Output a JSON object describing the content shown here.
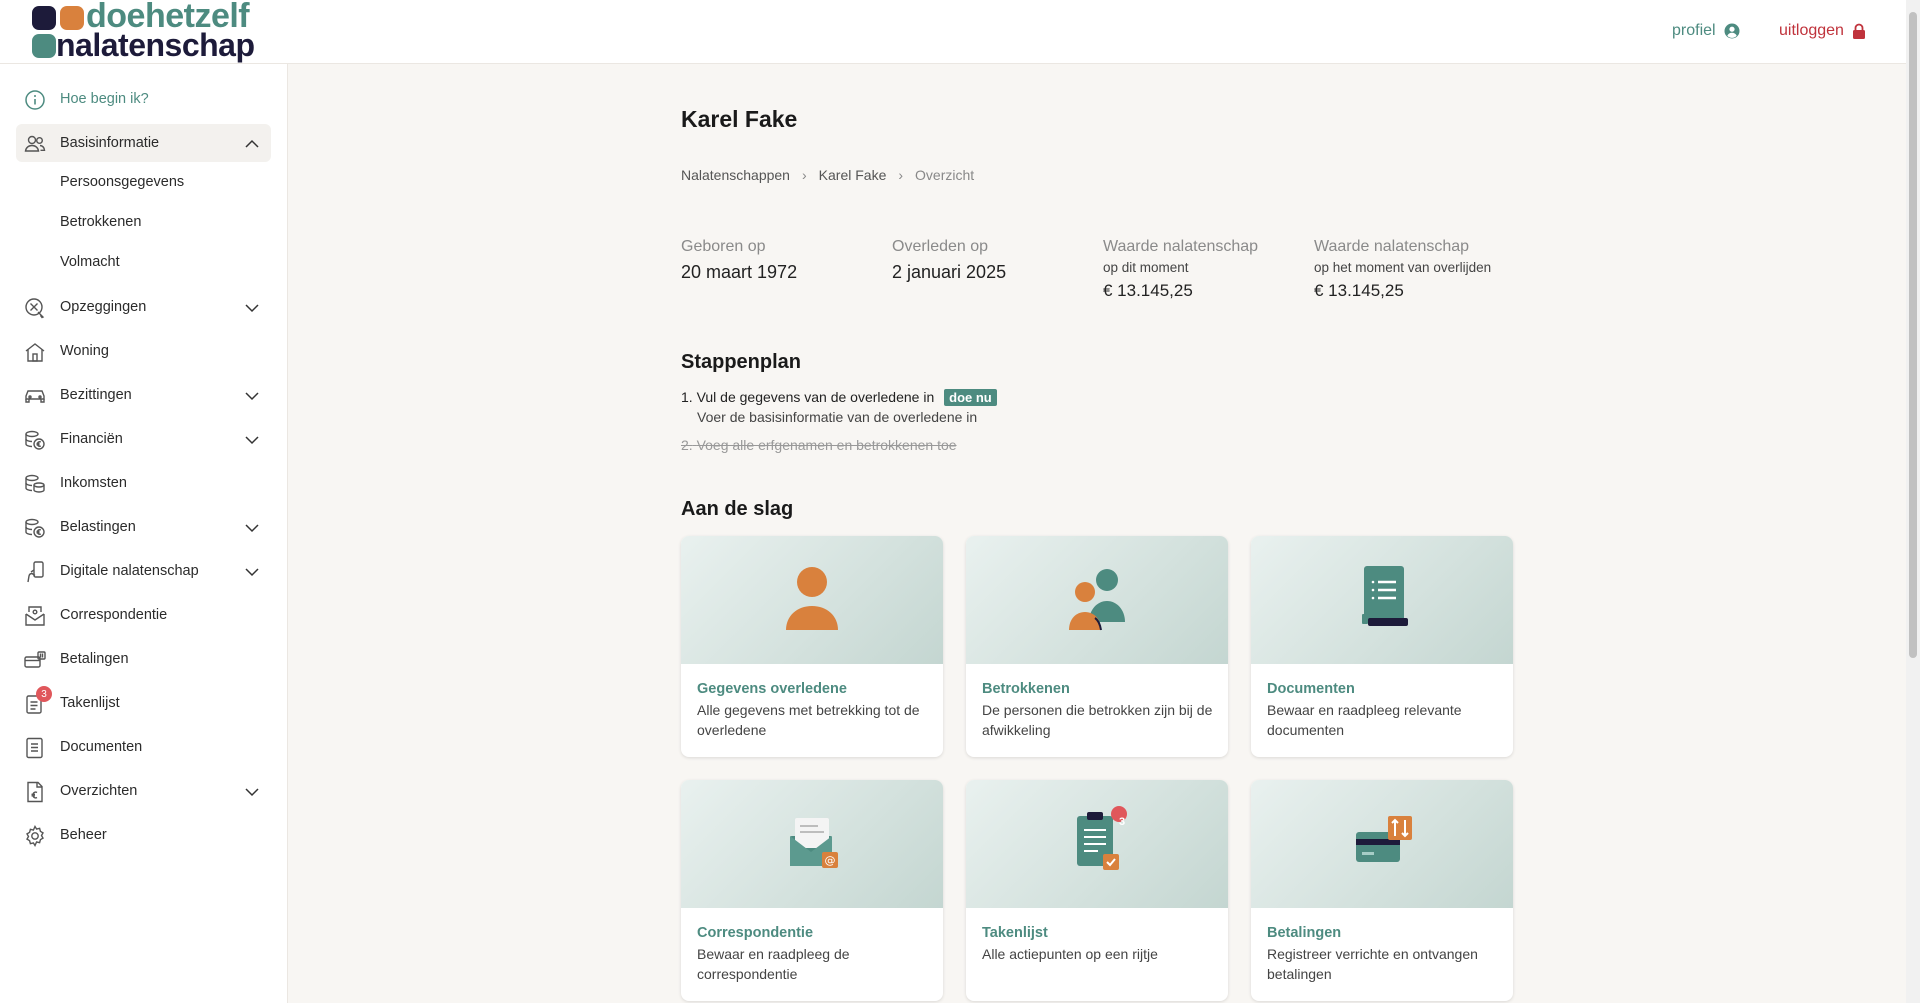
{
  "brand": {
    "line1": "doehetzelf",
    "line2": "nalatenschap"
  },
  "header": {
    "profile_label": "profiel",
    "logout_label": "uitloggen"
  },
  "sidebar": {
    "items": [
      {
        "label": "Hoe begin ik?",
        "icon": "info-icon"
      },
      {
        "label": "Basisinformatie",
        "icon": "people-icon",
        "expanded": true,
        "sub": [
          "Persoonsgegevens",
          "Betrokkenen",
          "Volmacht"
        ]
      },
      {
        "label": "Opzeggingen",
        "icon": "cancel-icon"
      },
      {
        "label": "Woning",
        "icon": "house-icon"
      },
      {
        "label": "Bezittingen",
        "icon": "car-icon"
      },
      {
        "label": "Financiën",
        "icon": "coins-euro-icon"
      },
      {
        "label": "Inkomsten",
        "icon": "coins-icon"
      },
      {
        "label": "Belastingen",
        "icon": "tax-coins-icon"
      },
      {
        "label": "Digitale nalatenschap",
        "icon": "phone-hand-icon"
      },
      {
        "label": "Correspondentie",
        "icon": "mail-icon"
      },
      {
        "label": "Betalingen",
        "icon": "payment-icon"
      },
      {
        "label": "Takenlijst",
        "icon": "tasklist-icon",
        "badge": "3"
      },
      {
        "label": "Documenten",
        "icon": "document-icon"
      },
      {
        "label": "Overzichten",
        "icon": "euro-doc-icon"
      },
      {
        "label": "Beheer",
        "icon": "gear-icon"
      }
    ]
  },
  "main": {
    "title": "Karel Fake",
    "breadcrumb": [
      "Nalatenschappen",
      "Karel Fake",
      "Overzicht"
    ],
    "stats": [
      {
        "label": "Geboren op",
        "value": "20 maart 1972"
      },
      {
        "label": "Overleden op",
        "value": "2 januari 2025"
      },
      {
        "label": "Waarde nalatenschap",
        "sub": "op dit moment",
        "value": "€ 13.145,25"
      },
      {
        "label": "Waarde nalatenschap",
        "sub": "op het moment van overlijden",
        "value": "€ 13.145,25"
      }
    ],
    "stappenplan": {
      "title": "Stappenplan",
      "steps": [
        {
          "num": "1.",
          "text": "Vul de gegevens van de overledene in",
          "action": "doe nu",
          "sub": "Voer de basisinformatie van de overledene in"
        },
        {
          "num": "2.",
          "text": "Voeg alle erfgenamen en betrokkenen toe",
          "done": true
        }
      ]
    },
    "aan_de_slag": {
      "title": "Aan de slag",
      "cards": [
        {
          "title": "Gegevens overledene",
          "desc": "Alle gegevens met betrekking tot de overledene",
          "icon": "person-icon"
        },
        {
          "title": "Betrokkenen",
          "desc": "De personen die betrokken zijn bij de afwikkeling",
          "icon": "people-icon"
        },
        {
          "title": "Documenten",
          "desc": "Bewaar en raadpleeg relevante documenten",
          "icon": "document-icon"
        },
        {
          "title": "Correspondentie",
          "desc": "Bewaar en raadpleeg de correspondentie",
          "icon": "envelope-icon"
        },
        {
          "title": "Takenlijst",
          "desc": "Alle actiepunten op een rijtje",
          "icon": "clipboard-icon",
          "badge": "3"
        },
        {
          "title": "Betalingen",
          "desc": "Registreer verrichte en ontvangen betalingen",
          "icon": "card-transfer-icon"
        }
      ]
    }
  },
  "colors": {
    "accent": "#4d8b80",
    "orange": "#d9813d",
    "navy": "#1d1b3a",
    "danger": "#c0333c"
  }
}
